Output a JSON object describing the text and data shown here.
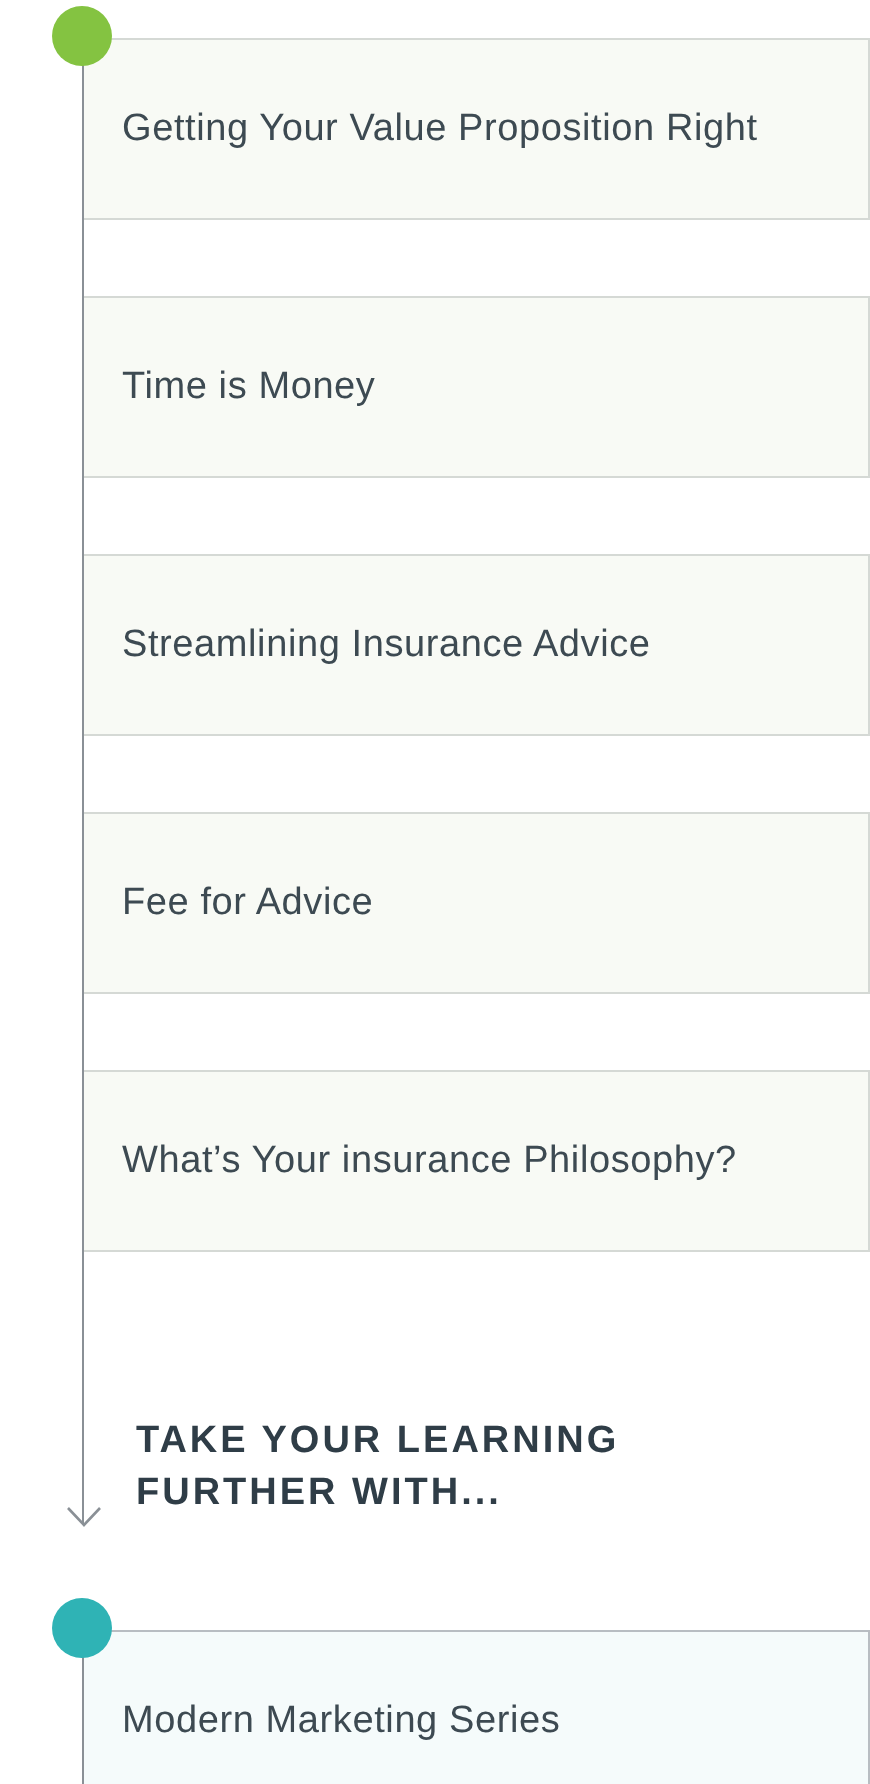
{
  "timelines": [
    {
      "kind": "course",
      "color": "#84c341",
      "items": [
        "Getting Your Value Proposition Right",
        "Time is Money",
        "Streamlining Insurance Advice",
        "Fee for Advice",
        "What’s Your insurance Philosophy?"
      ],
      "heading": "TAKE YOUR LEARNING FURTHER WITH..."
    },
    {
      "kind": "series",
      "color": "#2fb3b5",
      "items": [
        "Modern Marketing Series"
      ]
    }
  ]
}
